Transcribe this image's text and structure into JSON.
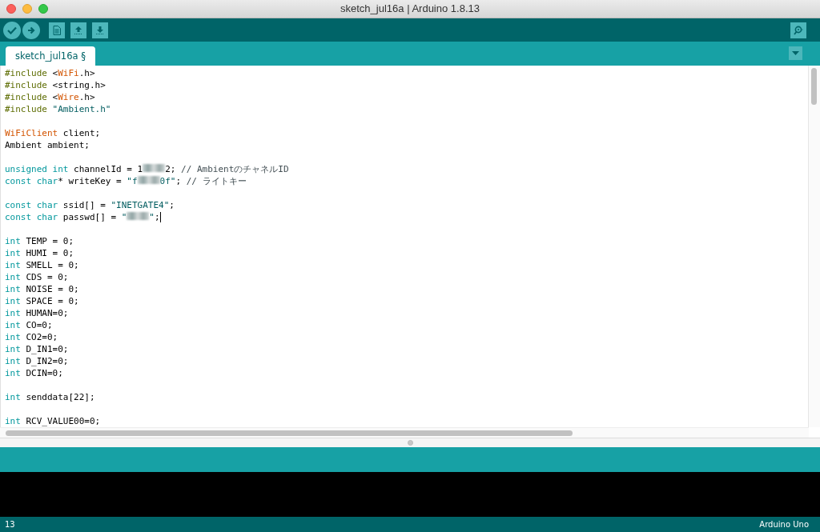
{
  "window": {
    "title": "sketch_jul16a | Arduino 1.8.13"
  },
  "tabs": [
    {
      "label": "sketch_jul16a §",
      "selected": true
    }
  ],
  "editor": {
    "lines": [
      {
        "kind": "code",
        "cursor": false,
        "tokens": [
          {
            "kind": "directive",
            "text": "#include"
          },
          {
            "kind": "plain",
            "text": " <"
          },
          {
            "kind": "type",
            "text": "WiFi"
          },
          {
            "kind": "plain",
            "text": ".h>"
          }
        ]
      },
      {
        "kind": "code",
        "cursor": false,
        "tokens": [
          {
            "kind": "directive",
            "text": "#include"
          },
          {
            "kind": "plain",
            "text": " <string.h>"
          }
        ]
      },
      {
        "kind": "code",
        "cursor": false,
        "tokens": [
          {
            "kind": "directive",
            "text": "#include"
          },
          {
            "kind": "plain",
            "text": " <"
          },
          {
            "kind": "type",
            "text": "Wire"
          },
          {
            "kind": "plain",
            "text": ".h>"
          }
        ]
      },
      {
        "kind": "code",
        "cursor": false,
        "tokens": [
          {
            "kind": "directive",
            "text": "#include"
          },
          {
            "kind": "string",
            "text": " \"Ambient.h\""
          }
        ]
      },
      {
        "kind": "blank"
      },
      {
        "kind": "code",
        "cursor": false,
        "tokens": [
          {
            "kind": "type",
            "text": "WiFiClient"
          },
          {
            "kind": "plain",
            "text": " client;"
          }
        ]
      },
      {
        "kind": "code",
        "cursor": false,
        "tokens": [
          {
            "kind": "plain",
            "text": "Ambient ambient;"
          }
        ]
      },
      {
        "kind": "blank"
      },
      {
        "kind": "code",
        "cursor": false,
        "tokens": [
          {
            "kind": "keyword",
            "text": "unsigned int"
          },
          {
            "kind": "plain",
            "text": " channelId = 1"
          },
          {
            "kind": "redacted"
          },
          {
            "kind": "plain",
            "text": "2; "
          },
          {
            "kind": "comment",
            "text": "// AmbientのチャネルID"
          }
        ]
      },
      {
        "kind": "code",
        "cursor": false,
        "tokens": [
          {
            "kind": "keyword",
            "text": "const char"
          },
          {
            "kind": "plain",
            "text": "* writeKey = "
          },
          {
            "kind": "string",
            "text": "\"f"
          },
          {
            "kind": "redacted"
          },
          {
            "kind": "string",
            "text": "0f\""
          },
          {
            "kind": "plain",
            "text": "; "
          },
          {
            "kind": "comment",
            "text": "// ライトキー"
          }
        ]
      },
      {
        "kind": "blank"
      },
      {
        "kind": "code",
        "cursor": false,
        "tokens": [
          {
            "kind": "keyword",
            "text": "const char"
          },
          {
            "kind": "plain",
            "text": " ssid[] = "
          },
          {
            "kind": "string",
            "text": "\"INETGATE4\""
          },
          {
            "kind": "plain",
            "text": ";"
          }
        ]
      },
      {
        "kind": "code",
        "cursor": true,
        "tokens": [
          {
            "kind": "keyword",
            "text": "const char"
          },
          {
            "kind": "plain",
            "text": " passwd[] = "
          },
          {
            "kind": "string",
            "text": "\""
          },
          {
            "kind": "redacted"
          },
          {
            "kind": "string",
            "text": "\""
          },
          {
            "kind": "plain",
            "text": ";"
          }
        ]
      },
      {
        "kind": "blank"
      },
      {
        "kind": "code",
        "cursor": false,
        "tokens": [
          {
            "kind": "keyword",
            "text": "int"
          },
          {
            "kind": "plain",
            "text": " TEMP = 0;"
          }
        ]
      },
      {
        "kind": "code",
        "cursor": false,
        "tokens": [
          {
            "kind": "keyword",
            "text": "int"
          },
          {
            "kind": "plain",
            "text": " HUMI = 0;"
          }
        ]
      },
      {
        "kind": "code",
        "cursor": false,
        "tokens": [
          {
            "kind": "keyword",
            "text": "int"
          },
          {
            "kind": "plain",
            "text": " SMELL = 0;"
          }
        ]
      },
      {
        "kind": "code",
        "cursor": false,
        "tokens": [
          {
            "kind": "keyword",
            "text": "int"
          },
          {
            "kind": "plain",
            "text": " CDS = 0;"
          }
        ]
      },
      {
        "kind": "code",
        "cursor": false,
        "tokens": [
          {
            "kind": "keyword",
            "text": "int"
          },
          {
            "kind": "plain",
            "text": " NOISE = 0;"
          }
        ]
      },
      {
        "kind": "code",
        "cursor": false,
        "tokens": [
          {
            "kind": "keyword",
            "text": "int"
          },
          {
            "kind": "plain",
            "text": " SPACE = 0;"
          }
        ]
      },
      {
        "kind": "code",
        "cursor": false,
        "tokens": [
          {
            "kind": "keyword",
            "text": "int"
          },
          {
            "kind": "plain",
            "text": " HUMAN=0;"
          }
        ]
      },
      {
        "kind": "code",
        "cursor": false,
        "tokens": [
          {
            "kind": "keyword",
            "text": "int"
          },
          {
            "kind": "plain",
            "text": " CO=0;"
          }
        ]
      },
      {
        "kind": "code",
        "cursor": false,
        "tokens": [
          {
            "kind": "keyword",
            "text": "int"
          },
          {
            "kind": "plain",
            "text": " CO2=0;"
          }
        ]
      },
      {
        "kind": "code",
        "cursor": false,
        "tokens": [
          {
            "kind": "keyword",
            "text": "int"
          },
          {
            "kind": "plain",
            "text": " D_IN1=0;"
          }
        ]
      },
      {
        "kind": "code",
        "cursor": false,
        "tokens": [
          {
            "kind": "keyword",
            "text": "int"
          },
          {
            "kind": "plain",
            "text": " D_IN2=0;"
          }
        ]
      },
      {
        "kind": "code",
        "cursor": false,
        "tokens": [
          {
            "kind": "keyword",
            "text": "int"
          },
          {
            "kind": "plain",
            "text": " DCIN=0;"
          }
        ]
      },
      {
        "kind": "blank"
      },
      {
        "kind": "code",
        "cursor": false,
        "tokens": [
          {
            "kind": "keyword",
            "text": "int"
          },
          {
            "kind": "plain",
            "text": " senddata[22];"
          }
        ]
      },
      {
        "kind": "blank"
      },
      {
        "kind": "code",
        "cursor": false,
        "tokens": [
          {
            "kind": "keyword",
            "text": "int"
          },
          {
            "kind": "plain",
            "text": " RCV_VALUE00=0;"
          }
        ]
      }
    ]
  },
  "status_bar": {
    "line": "13",
    "board": "Arduino Uno"
  }
}
